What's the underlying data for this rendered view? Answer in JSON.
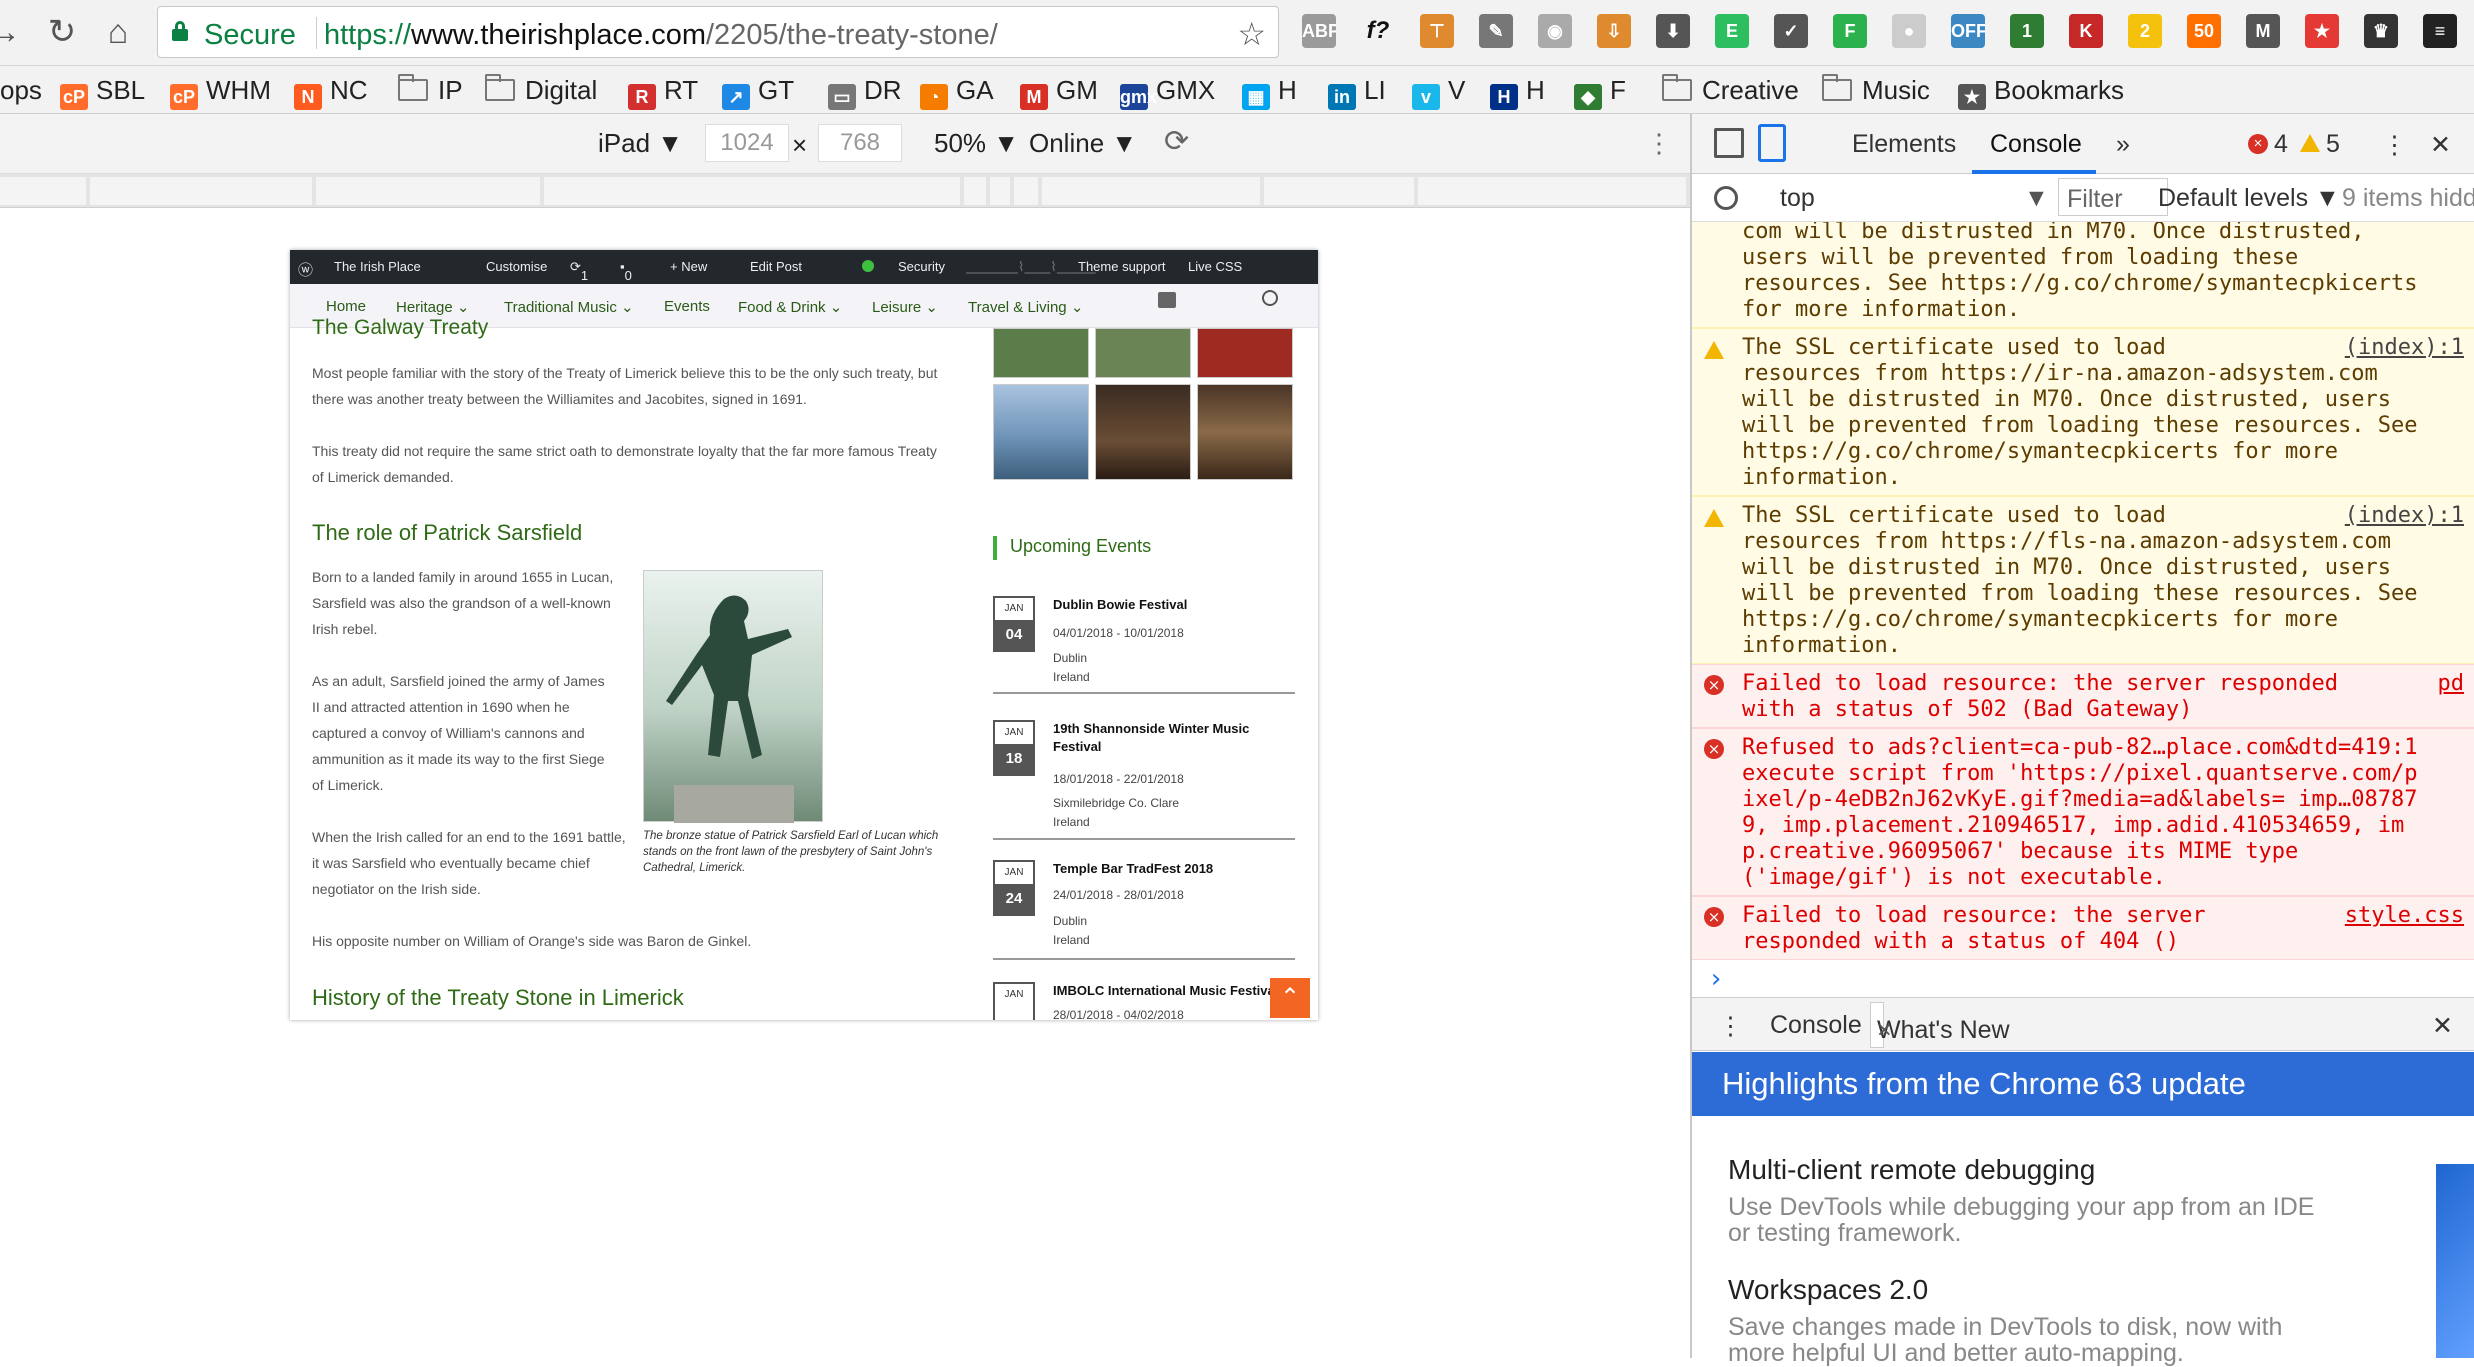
{
  "browser": {
    "nav_back": "→",
    "nav_reload": "↻",
    "nav_home": "⌂",
    "secure_label": "Secure",
    "url_scheme": "https://",
    "url_host": "www.theirishplace.com",
    "url_path": "/2205/the-treaty-stone/",
    "star_icon": "☆",
    "extensions": [
      {
        "name": "abp",
        "label": "ABP",
        "color": "#9a9a9a"
      },
      {
        "name": "formula",
        "label": "f?",
        "color": "#f2f2f2"
      },
      {
        "name": "tool",
        "label": "⊤",
        "color": "#e08a30"
      },
      {
        "name": "eyedropper",
        "label": "✎",
        "color": "#777777"
      },
      {
        "name": "camera",
        "label": "◉",
        "color": "#aaaaaa"
      },
      {
        "name": "download",
        "label": "⇩",
        "color": "#e08a30"
      },
      {
        "name": "shield",
        "label": "⬇",
        "color": "#555555"
      },
      {
        "name": "evernote",
        "label": "E",
        "color": "#2dbe60"
      },
      {
        "name": "pocket",
        "label": "✓",
        "color": "#555555"
      },
      {
        "name": "feedly",
        "label": "F",
        "color": "#2bb24c"
      },
      {
        "name": "moon",
        "label": "●",
        "color": "#cccccc"
      },
      {
        "name": "off",
        "label": "OFF",
        "color": "#3b88c3"
      },
      {
        "name": "calendar",
        "label": "1",
        "color": "#2e7d32"
      },
      {
        "name": "k",
        "label": "K",
        "color": "#c62828"
      },
      {
        "name": "bulb",
        "label": "2",
        "color": "#f4c20d"
      },
      {
        "name": "fifty",
        "label": "50",
        "color": "#ff6f00"
      },
      {
        "name": "m",
        "label": "M",
        "color": "#555555"
      },
      {
        "name": "starred",
        "label": "★",
        "color": "#e53935"
      },
      {
        "name": "crown",
        "label": "♛",
        "color": "#333333"
      },
      {
        "name": "stripes",
        "label": "≡",
        "color": "#222222"
      }
    ]
  },
  "bookmarks": [
    {
      "label": "ops",
      "icon": "",
      "color": ""
    },
    {
      "label": "SBL",
      "icon": "cP",
      "color": "#ff6c2c"
    },
    {
      "label": "WHM",
      "icon": "cP",
      "color": "#ff6c2c"
    },
    {
      "label": "NC",
      "icon": "N",
      "color": "#ff5a1f"
    },
    {
      "label": "IP",
      "icon": "folder",
      "color": ""
    },
    {
      "label": "Digital",
      "icon": "folder",
      "color": ""
    },
    {
      "label": "RT",
      "icon": "R",
      "color": "#d32f2f"
    },
    {
      "label": "GT",
      "icon": "↗",
      "color": "#1e88e5"
    },
    {
      "label": "DR",
      "icon": "▭",
      "color": "#777777"
    },
    {
      "label": "GA",
      "icon": "◔",
      "color": "#f57c00"
    },
    {
      "label": "GM",
      "icon": "M",
      "color": "#d93025"
    },
    {
      "label": "GMX",
      "icon": "gmx",
      "color": "#1c449b"
    },
    {
      "label": "H",
      "icon": "▦",
      "color": "#00a4ef"
    },
    {
      "label": "LI",
      "icon": "in",
      "color": "#0077b5"
    },
    {
      "label": "V",
      "icon": "v",
      "color": "#1ab7ea"
    },
    {
      "label": "H",
      "icon": "H",
      "color": "#003087"
    },
    {
      "label": "F",
      "icon": "◆",
      "color": "#2e7d32"
    },
    {
      "label": "Creative",
      "icon": "folder",
      "color": ""
    },
    {
      "label": "Music",
      "icon": "folder",
      "color": ""
    },
    {
      "label": "Bookmarks",
      "icon": "★",
      "color": "#555555"
    }
  ],
  "device_toolbar": {
    "device": "iPad ▼",
    "width": "1024",
    "times": "×",
    "height": "768",
    "zoom": "50% ▼",
    "network": "Online ▼",
    "rotate_icon": "⟳",
    "more_icon": "⋮"
  },
  "site": {
    "adminbar": {
      "site_name": "The Irish Place",
      "customise": "Customise",
      "updates": "1",
      "comments": "0",
      "new": "+ New",
      "edit_post": "Edit Post",
      "security": "Security",
      "theme_support": "Theme support",
      "live_css": "Live CSS"
    },
    "nav": [
      "Home",
      "Heritage ⌄",
      "Traditional Music ⌄",
      "Events",
      "Food & Drink ⌄",
      "Leisure ⌄",
      "Travel & Living ⌄"
    ],
    "heading_galway": "The Galway Treaty",
    "para1": "Most people familiar with the story of the Treaty of Limerick believe this to be the only such treaty, but there was another treaty between the Williamites and Jacobites, signed in 1691.",
    "para2": "This treaty did not require the same strict oath to demonstrate loyalty that the far more famous Treaty of Limerick demanded.",
    "heading_sarsfield": "The role of Patrick Sarsfield",
    "para3": "Born to a landed family in around 1655 in Lucan, Sarsfield was also the grandson of a well-known Irish rebel.",
    "para4": "As an adult, Sarsfield joined the army of James II and attracted attention in 1690 when he captured a convoy of William's cannons and ammunition as it made its way to the first Siege of Limerick.",
    "para5": "When the Irish called for an end to the 1691 battle, it was Sarsfield who eventually became chief negotiator on the Irish side.",
    "caption": "The bronze statue of Patrick Sarsfield Earl of Lucan which stands on the front lawn of the presbytery of Saint John's Cathedral, Limerick.",
    "para6": "His opposite number on William of Orange's side was Baron de Ginkel.",
    "heading_history": "History of the Treaty Stone in Limerick",
    "upcoming_title": "Upcoming Events",
    "events": [
      {
        "month": "JAN",
        "day": "04",
        "title": "Dublin Bowie Festival",
        "dates": "04/01/2018 - 10/01/2018",
        "city": "Dublin",
        "country": "Ireland"
      },
      {
        "month": "JAN",
        "day": "18",
        "title": "19th Shannonside Winter Music Festival",
        "dates": "18/01/2018 - 22/01/2018",
        "city": "Sixmilebridge Co. Clare",
        "country": "Ireland"
      },
      {
        "month": "JAN",
        "day": "24",
        "title": "Temple Bar TradFest 2018",
        "dates": "24/01/2018 - 28/01/2018",
        "city": "Dublin",
        "country": "Ireland"
      },
      {
        "month": "JAN",
        "day": "",
        "title": "IMBOLC International Music Festival",
        "dates": "28/01/2018 - 04/02/2018",
        "city": "",
        "country": ""
      }
    ]
  },
  "devtools": {
    "tab_elements": "Elements",
    "tab_console": "Console",
    "more_tabs": "»",
    "error_count": "4",
    "warning_count": "5",
    "context": "top",
    "filter_placeholder": "Filter",
    "levels": "Default levels ▼",
    "items_hidden": "9 items hidd",
    "messages": [
      {
        "type": "warn-cont",
        "lines": [
          "com will be distrusted in M70. Once distrusted,",
          "users will be prevented from loading these",
          "resources. See https://g.co/chrome/symantecpkicerts",
          "for more information."
        ],
        "source": ""
      },
      {
        "type": "warn",
        "lines": [
          "The SSL certificate used to load",
          "resources from https://ir-na.amazon-adsystem.com",
          "will be distrusted in M70. Once distrusted, users",
          "will be prevented from loading these resources. See",
          "https://g.co/chrome/symantecpkicerts for more",
          "information."
        ],
        "source": "(index):1"
      },
      {
        "type": "warn",
        "lines": [
          "The SSL certificate used to load",
          "resources from https://fls-na.amazon-adsystem.com",
          "will be distrusted in M70. Once distrusted, users",
          "will be prevented from loading these resources. See",
          "https://g.co/chrome/symantecpkicerts for more",
          "information."
        ],
        "source": "(index):1"
      },
      {
        "type": "error",
        "lines": [
          "Failed to load resource: the server responded",
          "with a status of 502 (Bad Gateway)"
        ],
        "source": "pd"
      },
      {
        "type": "error",
        "lines": [
          "Refused to ads?client=ca-pub-82…place.com&dtd=419:1",
          "execute script from 'https://pixel.quantserve.com/p",
          "ixel/p-4eDB2nJ62vKyE.gif?media=ad&labels= imp…08787",
          "9, imp.placement.210946517, imp.adid.410534659, im",
          "p.creative.96095067' because its MIME type",
          "('image/gif') is not executable."
        ],
        "source": ""
      },
      {
        "type": "error",
        "lines": [
          "Failed to load resource: the server",
          "responded with a status of 404 ()"
        ],
        "source": "style.css"
      }
    ],
    "prompt": "›",
    "drawer_console": "Console",
    "drawer_whatsnew": "What's New",
    "drawer_close": "×",
    "banner": "Highlights from the Chrome 63 update",
    "whatsnew_items": [
      {
        "title": "Multi-client remote debugging",
        "desc": "Use DevTools while debugging your app from an IDE or testing framework."
      },
      {
        "title": "Workspaces 2.0",
        "desc": "Save changes made in DevTools to disk, now with more helpful UI and better auto-mapping."
      }
    ]
  }
}
